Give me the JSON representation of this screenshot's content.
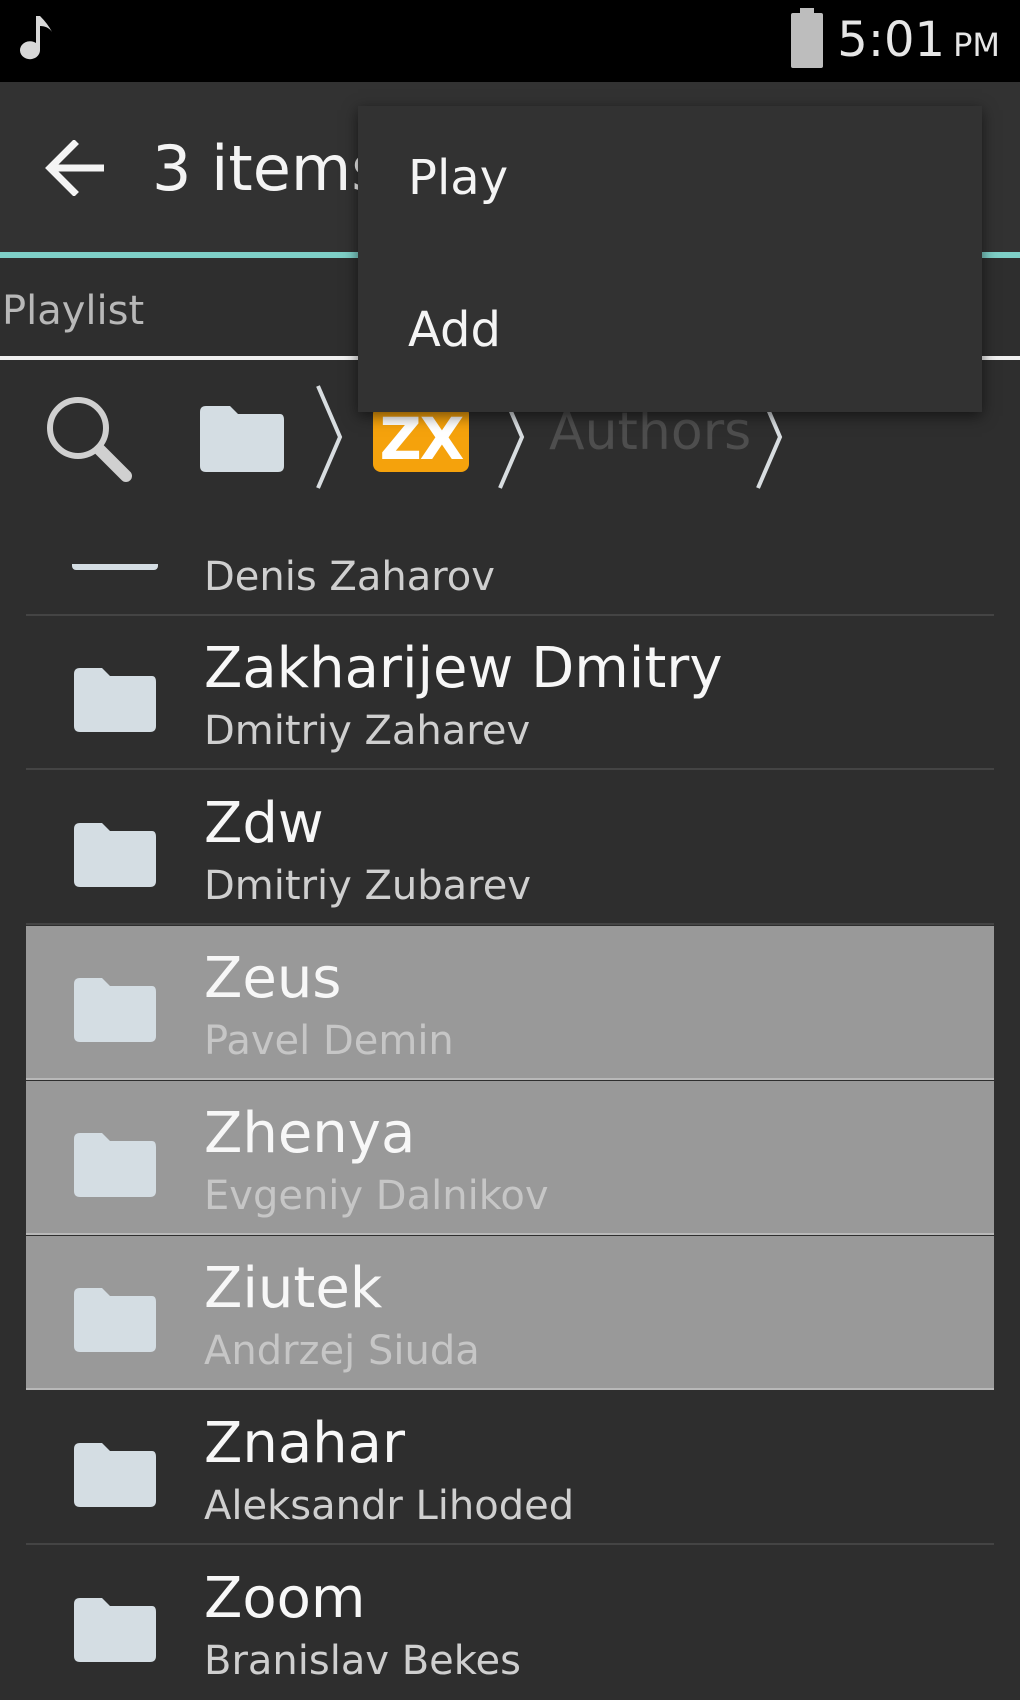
{
  "status_bar": {
    "time": "5:01",
    "ampm": "PM",
    "icons": [
      "music-note-icon",
      "battery-icon"
    ]
  },
  "action_bar": {
    "title": "3 items"
  },
  "tabs": {
    "active": "Playlist"
  },
  "breadcrumb": {
    "logo_text": "ZX",
    "current": "Authors"
  },
  "list": {
    "partial_subtitle": "Denis Zaharov",
    "items": [
      {
        "title": "Zakharijew Dmitry",
        "subtitle": "Dmitriy Zaharev",
        "selected": false
      },
      {
        "title": "Zdw",
        "subtitle": "Dmitriy Zubarev",
        "selected": false
      },
      {
        "title": "Zeus",
        "subtitle": "Pavel Demin",
        "selected": true
      },
      {
        "title": "Zhenya",
        "subtitle": "Evgeniy Dalnikov",
        "selected": true
      },
      {
        "title": "Ziutek",
        "subtitle": "Andrzej Siuda",
        "selected": true
      },
      {
        "title": "Znahar",
        "subtitle": "Aleksandr Lihoded",
        "selected": false
      },
      {
        "title": "Zoom",
        "subtitle": "Branislav Bekes",
        "selected": false
      }
    ]
  },
  "popup_menu": {
    "items": [
      "Play",
      "Add"
    ]
  },
  "colors": {
    "background": "#2e2e2e",
    "accent": "#7ecfc7",
    "selected_row": "#999999",
    "zx_logo": "#f5a20c"
  }
}
